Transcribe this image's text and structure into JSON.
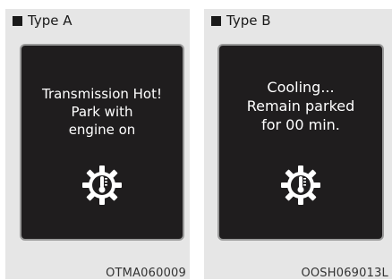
{
  "panels": [
    {
      "label": "Type A",
      "message_lines": [
        "Transmission Hot!",
        "Park with",
        "engine on"
      ],
      "icon": "transmission-temperature-icon",
      "code": "OTMA060009"
    },
    {
      "label": "Type B",
      "message_lines": [
        "Cooling...",
        "Remain parked",
        "for 00 min."
      ],
      "icon": "transmission-temperature-icon",
      "code": "OOSH069013L"
    }
  ],
  "colors": {
    "panel_background": "#e6e6e6",
    "display_background": "#1f1d1e",
    "display_border": "#9a9a9a",
    "display_text": "#ffffff"
  }
}
